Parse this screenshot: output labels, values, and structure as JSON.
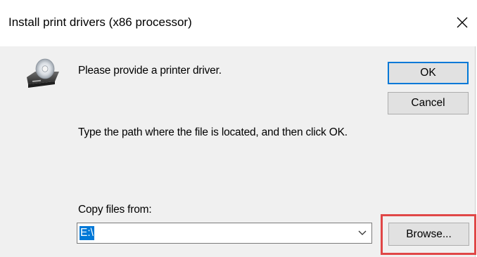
{
  "window": {
    "title": "Install print drivers (x86 processor)"
  },
  "icons": {
    "close": "close-icon",
    "driver": "disk-drive-icon",
    "dropdown": "chevron-down-icon"
  },
  "message": {
    "main": "Please provide a printer driver.",
    "instruction": "Type the path where the file is located, and then click OK.",
    "copy_label": "Copy files from:"
  },
  "buttons": {
    "ok": "OK",
    "cancel": "Cancel",
    "browse": "Browse..."
  },
  "path_field": {
    "value": "E:\\"
  },
  "colors": {
    "accent": "#0078d7",
    "highlight": "#e04747",
    "dialog_bg": "#f0f0f0"
  }
}
